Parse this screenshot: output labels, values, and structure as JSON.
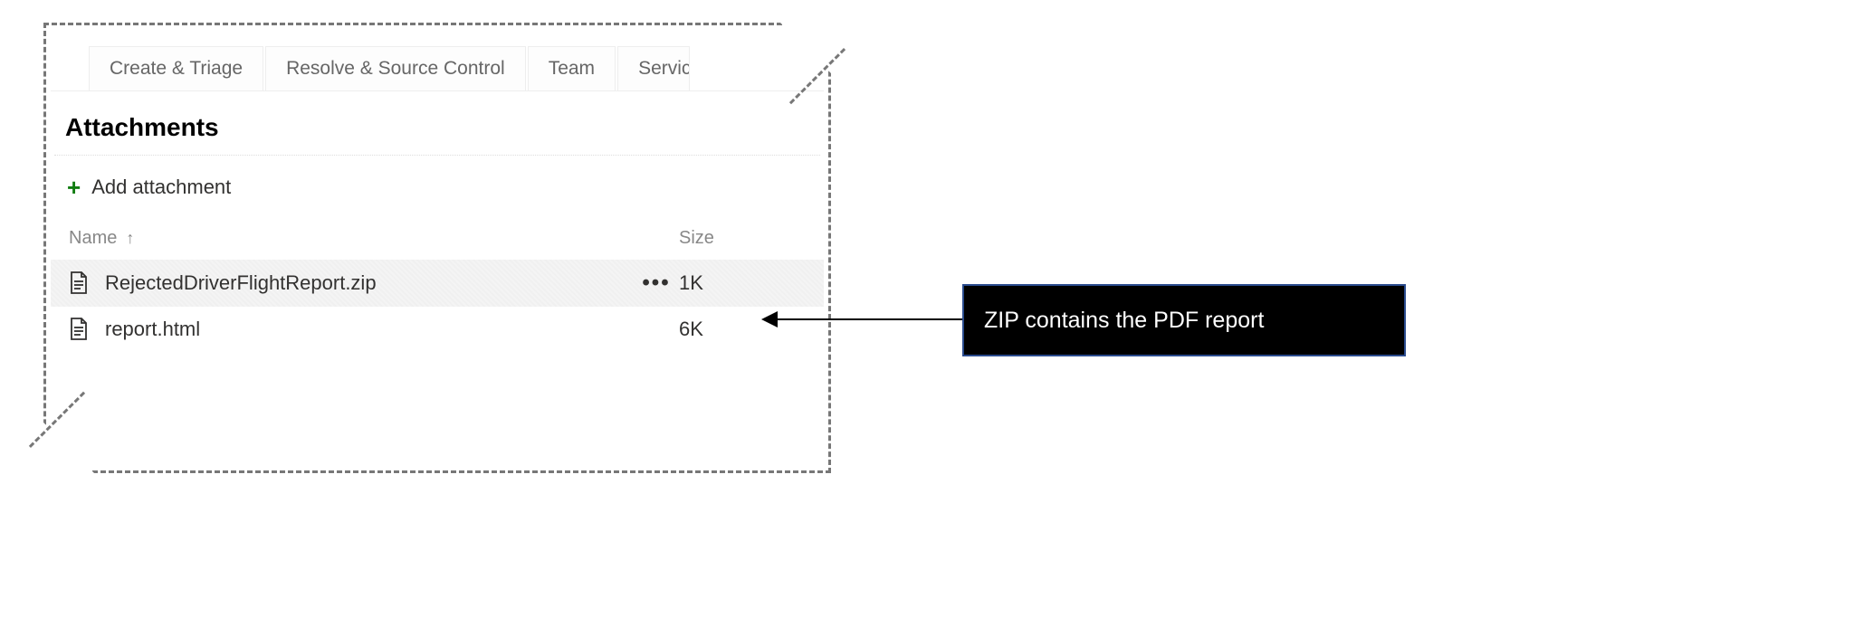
{
  "tabs": [
    {
      "label": "Create & Triage"
    },
    {
      "label": "Resolve & Source Control"
    },
    {
      "label": "Team"
    },
    {
      "label": "Servicing"
    }
  ],
  "section": {
    "title": "Attachments",
    "add_label": "Add attachment"
  },
  "columns": {
    "name": "Name",
    "sort_indicator": "↑",
    "size": "Size"
  },
  "files": [
    {
      "name": "RejectedDriverFlightReport.zip",
      "size": "1K",
      "selected": true,
      "more": "•••"
    },
    {
      "name": "report.html",
      "size": "6K",
      "selected": false,
      "more": ""
    }
  ],
  "annotation": {
    "text": "ZIP contains the PDF report"
  }
}
